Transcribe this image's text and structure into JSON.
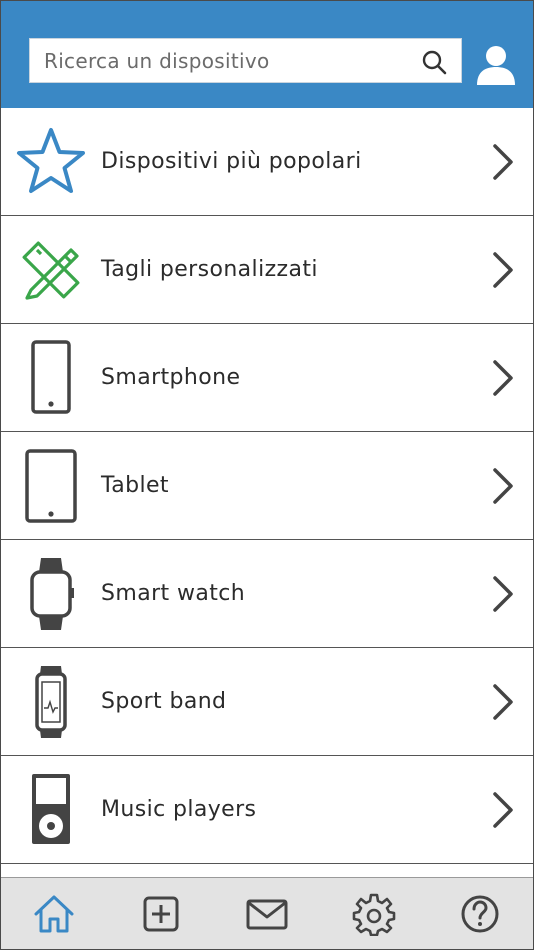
{
  "search": {
    "placeholder": "Ricerca un dispositivo",
    "icon": "search-icon"
  },
  "header": {
    "background": "#3a88c5",
    "account_icon": "user-icon"
  },
  "categories": [
    {
      "label": "Dispositivi più popolari",
      "icon": "star-icon",
      "icon_color": "#3a88c5"
    },
    {
      "label": "Tagli personalizzati",
      "icon": "pencil-ruler-icon",
      "icon_color": "#3aa64a"
    },
    {
      "label": "Smartphone",
      "icon": "smartphone-icon",
      "icon_color": "#444444"
    },
    {
      "label": "Tablet",
      "icon": "tablet-icon",
      "icon_color": "#444444"
    },
    {
      "label": "Smart watch",
      "icon": "smartwatch-icon",
      "icon_color": "#444444"
    },
    {
      "label": "Sport band",
      "icon": "sport-band-icon",
      "icon_color": "#444444"
    },
    {
      "label": "Music players",
      "icon": "music-player-icon",
      "icon_color": "#444444"
    }
  ],
  "tabbar": {
    "items": [
      {
        "icon": "home-icon",
        "active": true
      },
      {
        "icon": "add-icon",
        "active": false
      },
      {
        "icon": "mail-icon",
        "active": false
      },
      {
        "icon": "settings-icon",
        "active": false
      },
      {
        "icon": "help-icon",
        "active": false
      }
    ],
    "active_color": "#3a88c5"
  }
}
